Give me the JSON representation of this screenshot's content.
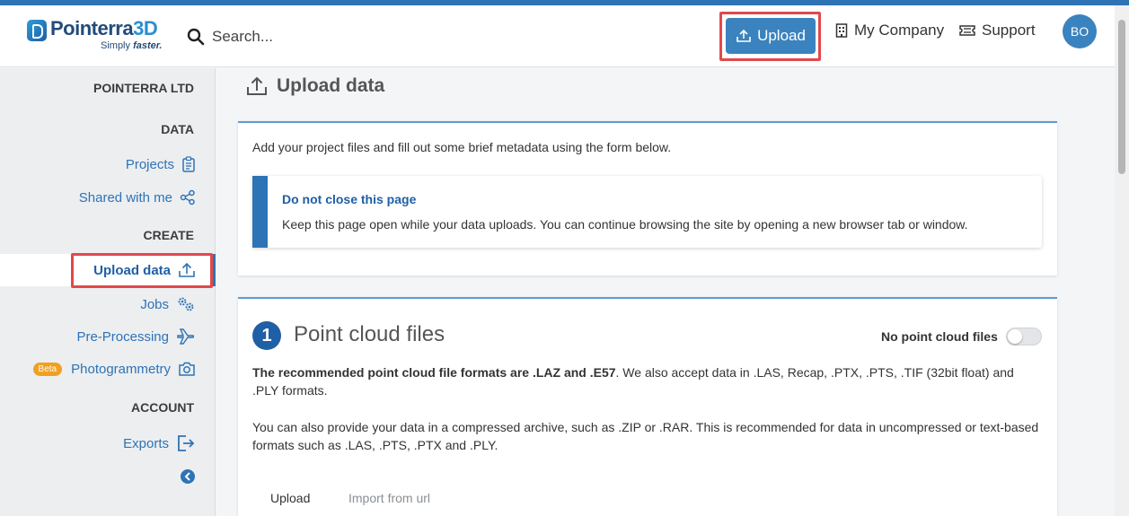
{
  "header": {
    "logo_name_main": "Pointerra",
    "logo_name_accent": "3D",
    "logo_tagline_prefix": "Simply",
    "logo_tagline_emphasis": "faster.",
    "search_placeholder": "Search...",
    "upload_label": "Upload",
    "my_company_label": "My Company",
    "support_label": "Support",
    "avatar_initials": "BO"
  },
  "sidebar": {
    "org_name": "POINTERRA LTD",
    "sections": {
      "data": "DATA",
      "create": "CREATE",
      "account": "ACCOUNT"
    },
    "items": [
      {
        "label": "Projects",
        "icon": "clipboard-icon"
      },
      {
        "label": "Shared with me",
        "icon": "share-icon"
      },
      {
        "label": "Upload data",
        "icon": "upload-icon",
        "active": true
      },
      {
        "label": "Jobs",
        "icon": "gears-icon"
      },
      {
        "label": "Pre-Processing",
        "icon": "plane-icon"
      },
      {
        "label": "Photogrammetry",
        "icon": "camera-icon",
        "badge": "Beta"
      },
      {
        "label": "Exports",
        "icon": "export-icon"
      }
    ]
  },
  "page": {
    "title": "Upload data",
    "intro": "Add your project files and fill out some brief metadata using the form below.",
    "notice_title": "Do not close this page",
    "notice_body": "Keep this page open while your data uploads. You can continue browsing the site by opening a new browser tab or window.",
    "step_number": "1",
    "step_title": "Point cloud files",
    "toggle_label": "No point cloud files",
    "toggle_on": false,
    "para1_bold": "The recommended point cloud file formats are .LAZ and .E57",
    "para1_rest": ". We also accept data in .LAS, Recap, .PTX, .PTS, .TIF (32bit float) and .PLY formats.",
    "para2": "You can also provide your data in a compressed archive, such as .ZIP or .RAR. This is recommended for data in uncompressed or text-based formats such as .LAS, .PTS, .PTX and .PLY.",
    "tabs": [
      "Upload",
      "Import from url"
    ]
  },
  "colors": {
    "brand_blue": "#2e73b5",
    "highlight_red": "#e2484b"
  }
}
